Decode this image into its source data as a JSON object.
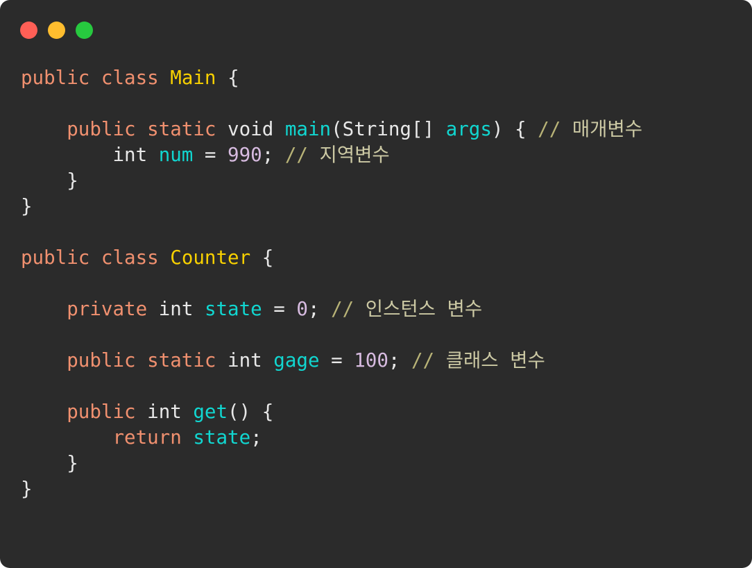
{
  "window": {
    "kind": "code-snippet-window",
    "background": "#2b2b2b",
    "corner_radius_px": 14,
    "traffic_lights": [
      {
        "name": "close",
        "color": "#ff5f56"
      },
      {
        "name": "minimize",
        "color": "#ffbd2e"
      },
      {
        "name": "maximize",
        "color": "#27c93f"
      }
    ]
  },
  "theme": {
    "background": "#2b2b2b",
    "default_text": "#e8e8e8",
    "keyword": "#f0906f",
    "class_name": "#f7d000",
    "identifier": "#11d6d0",
    "number": "#d7bbe0",
    "comment": "#b8b377",
    "comment_text": "#ccc9a4"
  },
  "code": {
    "language": "java",
    "lines": [
      {
        "n": 1,
        "text": "public class Main {"
      },
      {
        "n": 2,
        "text": ""
      },
      {
        "n": 3,
        "text": "    public static void main(String[] args) { // 매개변수"
      },
      {
        "n": 4,
        "text": "        int num = 990; // 지역변수"
      },
      {
        "n": 5,
        "text": "    }"
      },
      {
        "n": 6,
        "text": "}"
      },
      {
        "n": 7,
        "text": ""
      },
      {
        "n": 8,
        "text": "public class Counter {"
      },
      {
        "n": 9,
        "text": ""
      },
      {
        "n": 10,
        "text": "    private int state = 0; // 인스턴스 변수"
      },
      {
        "n": 11,
        "text": ""
      },
      {
        "n": 12,
        "text": "    public static int gage = 100; // 클래스 변수"
      },
      {
        "n": 13,
        "text": ""
      },
      {
        "n": 14,
        "text": "    public int get() {"
      },
      {
        "n": 15,
        "text": "        return state;"
      },
      {
        "n": 16,
        "text": "    }"
      },
      {
        "n": 17,
        "text": "}"
      }
    ],
    "tokens": {
      "l1": {
        "kw1": "public",
        "kw2": "class",
        "cls": "Main",
        "brace": "{"
      },
      "l3": {
        "kw1": "public",
        "kw2": "static",
        "type": "void",
        "fn": "main",
        "paren_open": "(",
        "type2": "String[]",
        "arg": "args",
        "paren_close": ")",
        "brace": "{",
        "comment_slashes": "//",
        "comment_text": "매개변수"
      },
      "l4": {
        "type": "int",
        "var": "num",
        "eq": "=",
        "num": "990",
        "semi": ";",
        "comment_slashes": "//",
        "comment_text": "지역변수"
      },
      "l5": {
        "brace": "}"
      },
      "l6": {
        "brace": "}"
      },
      "l8": {
        "kw1": "public",
        "kw2": "class",
        "cls": "Counter",
        "brace": "{"
      },
      "l10": {
        "kw1": "private",
        "type": "int",
        "var": "state",
        "eq": "=",
        "num": "0",
        "semi": ";",
        "comment_slashes": "//",
        "comment_text": "인스턴스 변수"
      },
      "l12": {
        "kw1": "public",
        "kw2": "static",
        "type": "int",
        "var": "gage",
        "eq": "=",
        "num": "100",
        "semi": ";",
        "comment_slashes": "//",
        "comment_text": "클래스 변수"
      },
      "l14": {
        "kw1": "public",
        "type": "int",
        "fn": "get",
        "parens": "()",
        "brace": "{"
      },
      "l15": {
        "kw1": "return",
        "var": "state",
        "semi": ";"
      },
      "l16": {
        "brace": "}"
      },
      "l17": {
        "brace": "}"
      }
    },
    "indent": {
      "i0": "",
      "i1": "    ",
      "i2": "        "
    },
    "space": " "
  }
}
